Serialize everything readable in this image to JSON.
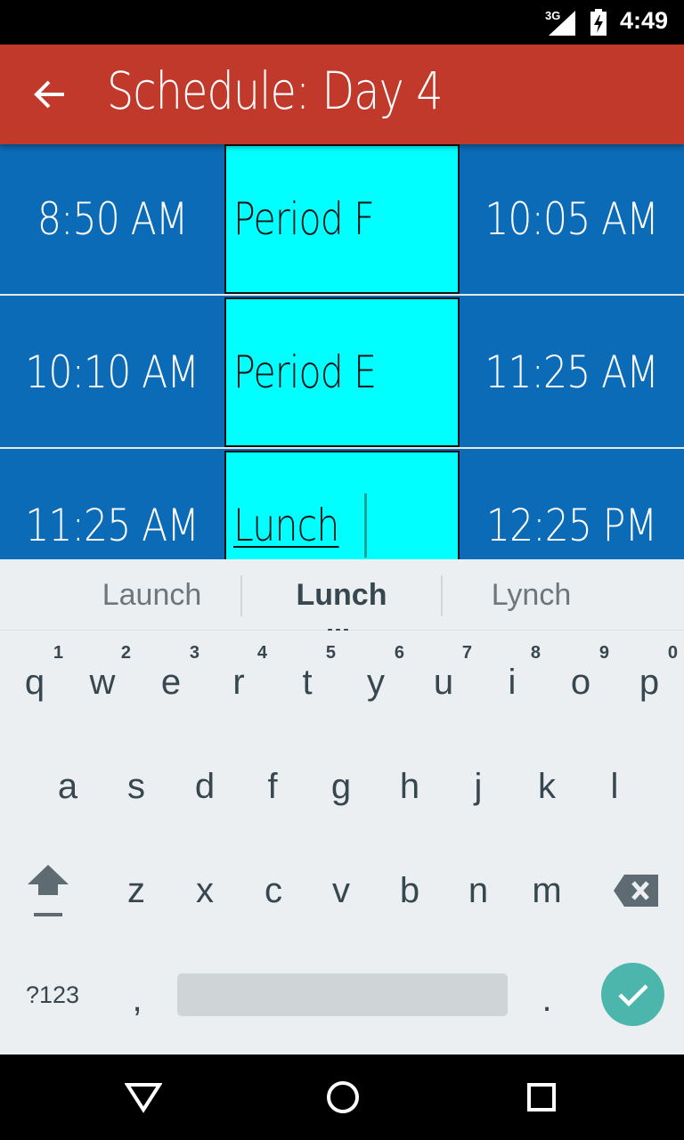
{
  "status_bar": {
    "network": "3G",
    "time": "4:49",
    "icons": [
      "signal-icon",
      "battery-icon"
    ]
  },
  "app_bar": {
    "title": "Schedule: Day 4",
    "back_icon": "back-arrow-icon"
  },
  "schedule": {
    "rows": [
      {
        "start": "8:50 AM",
        "period": "Period F",
        "end": "10:05 AM"
      },
      {
        "start": "10:10 AM",
        "period": "Period E",
        "end": "11:25 AM"
      },
      {
        "start": "11:25 AM",
        "period": "Lunch",
        "end": "12:25 PM"
      }
    ]
  },
  "keyboard": {
    "suggestions": [
      "Launch",
      "Lunch",
      "Lynch"
    ],
    "row1": [
      {
        "key": "q",
        "hint": "1"
      },
      {
        "key": "w",
        "hint": "2"
      },
      {
        "key": "e",
        "hint": "3"
      },
      {
        "key": "r",
        "hint": "4"
      },
      {
        "key": "t",
        "hint": "5"
      },
      {
        "key": "y",
        "hint": "6"
      },
      {
        "key": "u",
        "hint": "7"
      },
      {
        "key": "i",
        "hint": "8"
      },
      {
        "key": "o",
        "hint": "9"
      },
      {
        "key": "p",
        "hint": "0"
      }
    ],
    "row2": [
      "a",
      "s",
      "d",
      "f",
      "g",
      "h",
      "j",
      "k",
      "l"
    ],
    "row3": [
      "z",
      "x",
      "c",
      "v",
      "b",
      "n",
      "m"
    ],
    "symbols_label": "?123",
    "comma": ",",
    "period": ".",
    "shift_icon": "shift-icon",
    "delete_icon": "backspace-icon",
    "enter_icon": "checkmark-icon",
    "accent_color": "#4db6ac"
  },
  "nav_bar": {
    "icons": [
      "back-triangle-icon",
      "home-circle-icon",
      "recents-square-icon"
    ]
  },
  "colors": {
    "app_bar": "#c0392b",
    "row_background": "#0b6bb7",
    "period_cell": "#00ffff"
  }
}
